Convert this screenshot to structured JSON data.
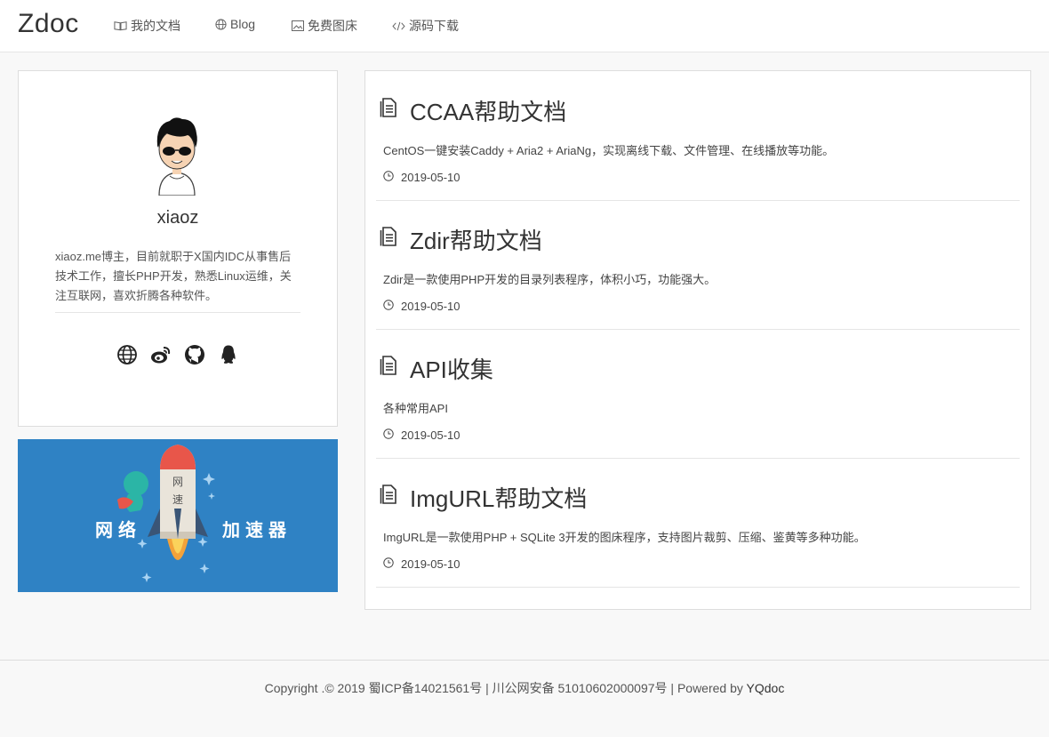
{
  "brand": "Zdoc",
  "nav": [
    {
      "label": "我的文档",
      "icon": "book-icon"
    },
    {
      "label": "Blog",
      "icon": "globe-icon"
    },
    {
      "label": "免费图床",
      "icon": "image-icon"
    },
    {
      "label": "源码下载",
      "icon": "code-icon"
    }
  ],
  "profile": {
    "name": "xiaoz",
    "description": "xiaoz.me博主，目前就职于X国内IDC从事售后技术工作，擅长PHP开发，熟悉Linux运维，关注互联网，喜欢折腾各种软件。",
    "social": [
      "globe-icon",
      "weibo-icon",
      "github-icon",
      "qq-icon"
    ]
  },
  "banner": {
    "left_text": "网络",
    "right_text": "加速器",
    "rocket_text": "网速"
  },
  "docs": [
    {
      "title": "CCAA帮助文档",
      "description": "CentOS一键安装Caddy + Aria2 + AriaNg，实现离线下载、文件管理、在线播放等功能。",
      "date": "2019-05-10"
    },
    {
      "title": "Zdir帮助文档",
      "description": "Zdir是一款使用PHP开发的目录列表程序，体积小巧，功能强大。",
      "date": "2019-05-10"
    },
    {
      "title": "API收集",
      "description": "各种常用API",
      "date": "2019-05-10"
    },
    {
      "title": "ImgURL帮助文档",
      "description": "ImgURL是一款使用PHP + SQLite 3开发的图床程序，支持图片裁剪、压缩、鉴黄等多种功能。",
      "date": "2019-05-10"
    }
  ],
  "footer": {
    "text": "Copyright .© 2019 蜀ICP备14021561号 | 川公网安备 51010602000097号 | Powered by ",
    "link": "YQdoc"
  }
}
